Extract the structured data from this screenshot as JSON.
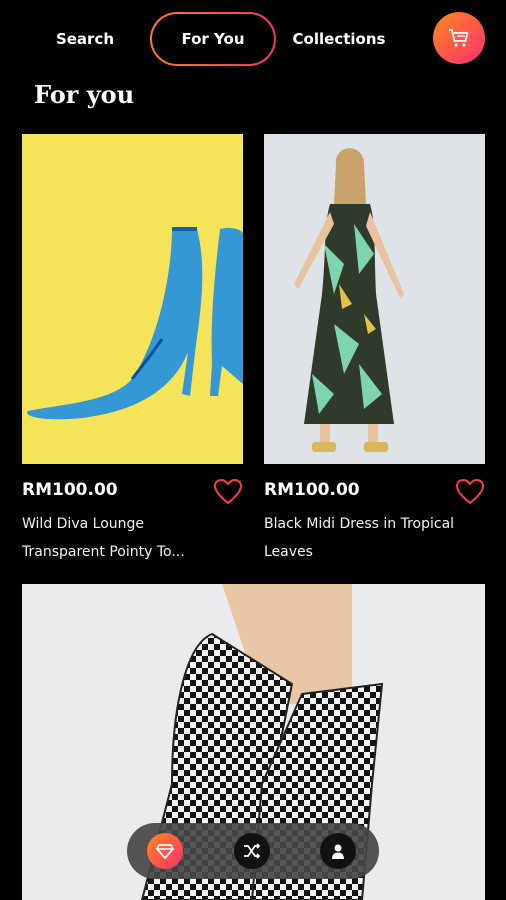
{
  "nav": {
    "tabs": [
      {
        "label": "Search"
      },
      {
        "label": "For You"
      },
      {
        "label": "Collections"
      }
    ],
    "cart_icon": "cart-icon"
  },
  "page": {
    "title": "For you"
  },
  "products": [
    {
      "price": "RM100.00",
      "name": "Wild Diva Lounge Transparent Pointy To...",
      "image": "blue transparent pointy heeled boots on yellow background"
    },
    {
      "price": "RM100.00",
      "name": "Black Midi Dress in Tropical Leaves",
      "image": "woman wearing black tropical leaf midi dress"
    },
    {
      "image": "black and white checkered knee-high boots"
    }
  ],
  "bottom_nav": {
    "icons": [
      "diamond-icon",
      "shuffle-icon",
      "user-icon"
    ]
  },
  "colors": {
    "accent_start": "#ff8a1d",
    "accent_end": "#ff2d6f",
    "heart": "#ff3b45"
  }
}
